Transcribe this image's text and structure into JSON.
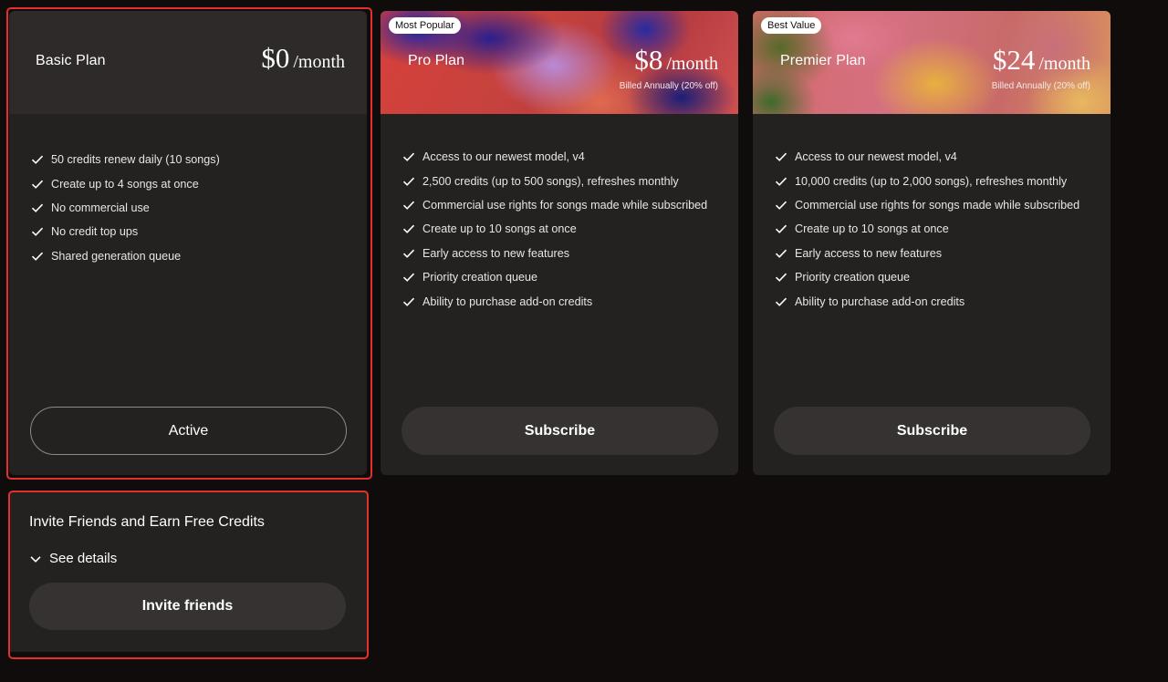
{
  "plans": [
    {
      "name": "Basic Plan",
      "amount": "$0",
      "unit": "/month",
      "billed": "",
      "badge": "",
      "features": [
        "50 credits renew daily (10 songs)",
        "Create up to 4 songs at once",
        "No commercial use",
        "No credit top ups",
        "Shared generation queue"
      ],
      "button": "Active"
    },
    {
      "name": "Pro Plan",
      "amount": "$8",
      "unit": "/month",
      "billed": "Billed Annually (20% off)",
      "badge": "Most Popular",
      "features": [
        "Access to our newest model, v4",
        "2,500 credits (up to 500 songs), refreshes monthly",
        "Commercial use rights for songs made while subscribed",
        "Create up to 10 songs at once",
        "Early access to new features",
        "Priority creation queue",
        "Ability to purchase add-on credits"
      ],
      "button": "Subscribe"
    },
    {
      "name": "Premier Plan",
      "amount": "$24",
      "unit": "/month",
      "billed": "Billed Annually (20% off)",
      "badge": "Best Value",
      "features": [
        "Access to our newest model, v4",
        "10,000 credits (up to 2,000 songs), refreshes monthly",
        "Commercial use rights for songs made while subscribed",
        "Create up to 10 songs at once",
        "Early access to new features",
        "Priority creation queue",
        "Ability to purchase add-on credits"
      ],
      "button": "Subscribe"
    }
  ],
  "invite": {
    "title": "Invite Friends and Earn Free Credits",
    "details": "See details",
    "button": "Invite friends"
  },
  "icons": {
    "feature": "check-icon",
    "details": "chevron-down-icon"
  },
  "colors": {
    "background": "#100c0b",
    "card": "#242121",
    "highlight": "#e4302a"
  }
}
